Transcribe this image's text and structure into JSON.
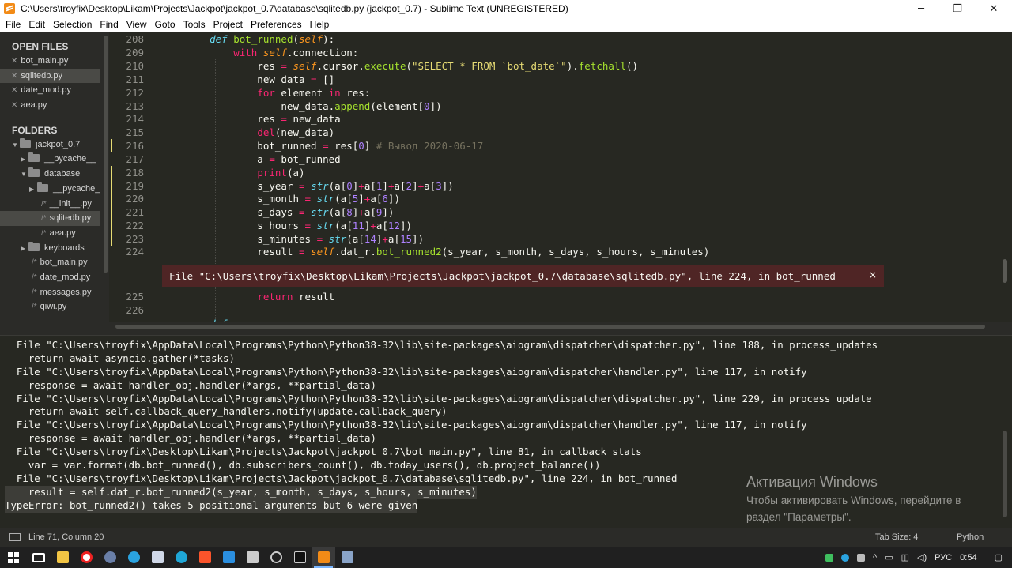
{
  "window": {
    "title": "C:\\Users\\troyfix\\Desktop\\Likam\\Projects\\Jackpot\\jackpot_0.7\\database\\sqlitedb.py (jackpot_0.7) - Sublime Text (UNREGISTERED)",
    "minimize": "─",
    "maximize": "❐",
    "close": "✕"
  },
  "menu": [
    "File",
    "Edit",
    "Selection",
    "Find",
    "View",
    "Goto",
    "Tools",
    "Project",
    "Preferences",
    "Help"
  ],
  "sidebar": {
    "open_files_label": "OPEN FILES",
    "open_files": [
      "bot_main.py",
      "sqlitedb.py",
      "date_mod.py",
      "aea.py"
    ],
    "folders_label": "FOLDERS",
    "tree": [
      {
        "label": "jackpot_0.7",
        "type": "folder-open"
      },
      {
        "label": "__pycache__",
        "type": "folder"
      },
      {
        "label": "database",
        "type": "folder-open"
      },
      {
        "label": "__pycache_",
        "type": "folder"
      },
      {
        "label": "__init__.py",
        "type": "file"
      },
      {
        "label": "sqlitedb.py",
        "type": "file"
      },
      {
        "label": "aea.py",
        "type": "file"
      },
      {
        "label": "keyboards",
        "type": "folder"
      },
      {
        "label": "bot_main.py",
        "type": "file"
      },
      {
        "label": "date_mod.py",
        "type": "file"
      },
      {
        "label": "messages.py",
        "type": "file"
      },
      {
        "label": "qiwi.py",
        "type": "file"
      }
    ]
  },
  "editor": {
    "line_numbers": [
      "208",
      "209",
      "210",
      "211",
      "212",
      "213",
      "214",
      "215",
      "216",
      "217",
      "218",
      "219",
      "220",
      "221",
      "222",
      "223",
      "224",
      "225",
      "226"
    ],
    "error_phantom": "File \"C:\\Users\\troyfix\\Desktop\\Likam\\Projects\\Jackpot\\jackpot_0.7\\database\\sqlitedb.py\", line 224, in bot_runned",
    "error_close": "×"
  },
  "console": {
    "lines": [
      "  File \"C:\\Users\\troyfix\\AppData\\Local\\Programs\\Python\\Python38-32\\lib\\site-packages\\aiogram\\dispatcher\\dispatcher.py\", line 188, in process_updates",
      "    return await asyncio.gather(*tasks)",
      "  File \"C:\\Users\\troyfix\\AppData\\Local\\Programs\\Python\\Python38-32\\lib\\site-packages\\aiogram\\dispatcher\\handler.py\", line 117, in notify",
      "    response = await handler_obj.handler(*args, **partial_data)",
      "  File \"C:\\Users\\troyfix\\AppData\\Local\\Programs\\Python\\Python38-32\\lib\\site-packages\\aiogram\\dispatcher\\dispatcher.py\", line 229, in process_update",
      "    return await self.callback_query_handlers.notify(update.callback_query)",
      "  File \"C:\\Users\\troyfix\\AppData\\Local\\Programs\\Python\\Python38-32\\lib\\site-packages\\aiogram\\dispatcher\\handler.py\", line 117, in notify",
      "    response = await handler_obj.handler(*args, **partial_data)",
      "  File \"C:\\Users\\troyfix\\Desktop\\Likam\\Projects\\Jackpot\\jackpot_0.7\\bot_main.py\", line 81, in callback_stats",
      "    var = var.format(db.bot_runned(), db.subscribers_count(), db.today_users(), db.project_balance())",
      "  File \"C:\\Users\\troyfix\\Desktop\\Likam\\Projects\\Jackpot\\jackpot_0.7\\database\\sqlitedb.py\", line 224, in bot_runned",
      "    result = self.dat_r.bot_runned2(s_year, s_month, s_days, s_hours, s_minutes)",
      "TypeError: bot_runned2() takes 5 positional arguments but 6 were given"
    ]
  },
  "activation": {
    "title": "Активация Windows",
    "body": "Чтобы активировать Windows, перейдите в раздел \"Параметры\"."
  },
  "statusbar": {
    "position": "Line 71, Column 20",
    "tab_size": "Tab Size: 4",
    "syntax": "Python"
  },
  "taskbar": {
    "lang": "РУС",
    "time": "0:54"
  },
  "colors": {
    "editor_bg": "#272822",
    "keyword": "#f92672",
    "function": "#a6e22e",
    "string": "#e6db74",
    "number": "#ae81ff",
    "comment": "#75715e",
    "error_bg": "#4f2525"
  }
}
